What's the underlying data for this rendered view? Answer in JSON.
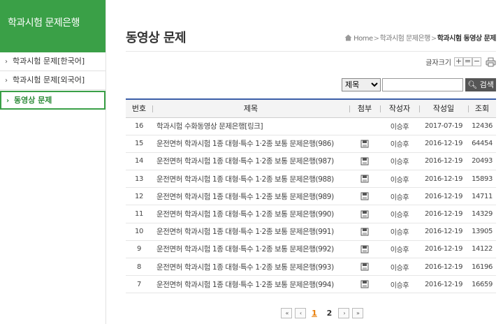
{
  "sidebar": {
    "title": "학과시험 문제은행",
    "items": [
      {
        "label": "학과시험 문제[한국어]",
        "active": false
      },
      {
        "label": "학과시험 문제[외국어]",
        "active": false
      },
      {
        "label": "동영상 문제",
        "active": true
      }
    ]
  },
  "header": {
    "title": "동영상 문제",
    "breadcrumb": {
      "home": "Home",
      "parent": "학과시험 문제은행",
      "current": "학과시험 동영상 문제"
    }
  },
  "fontsize": {
    "label": "글자크기",
    "increase": "+",
    "reset": "=",
    "decrease": "−"
  },
  "search": {
    "field_selected": "제목",
    "query_value": "",
    "button_label": "검색"
  },
  "table": {
    "columns": [
      "번호",
      "제목",
      "첨부",
      "작성자",
      "작성일",
      "조회"
    ],
    "rows": [
      {
        "no": "16",
        "title": "학과시험 수화동영상 문제은행[링크]",
        "attach": false,
        "author": "이승후",
        "date": "2017-07-19",
        "views": "12436"
      },
      {
        "no": "15",
        "title": "운전면허 학과시험 1종 대형·특수 1·2종 보통 문제은행(986)",
        "attach": true,
        "author": "이승후",
        "date": "2016-12-19",
        "views": "64454"
      },
      {
        "no": "14",
        "title": "운전면허 학과시험 1종 대형·특수 1·2종 보통 문제은행(987)",
        "attach": true,
        "author": "이승후",
        "date": "2016-12-19",
        "views": "20493"
      },
      {
        "no": "13",
        "title": "운전면허 학과시험 1종 대형·특수 1·2종 보통 문제은행(988)",
        "attach": true,
        "author": "이승후",
        "date": "2016-12-19",
        "views": "15893"
      },
      {
        "no": "12",
        "title": "운전면허 학과시험 1종 대형·특수 1·2종 보통 문제은행(989)",
        "attach": true,
        "author": "이승후",
        "date": "2016-12-19",
        "views": "14711"
      },
      {
        "no": "11",
        "title": "운전면허 학과시험 1종 대형·특수 1·2종 보통 문제은행(990)",
        "attach": true,
        "author": "이승후",
        "date": "2016-12-19",
        "views": "14329"
      },
      {
        "no": "10",
        "title": "운전면허 학과시험 1종 대형·특수 1·2종 보통 문제은행(991)",
        "attach": true,
        "author": "이승후",
        "date": "2016-12-19",
        "views": "13905"
      },
      {
        "no": "9",
        "title": "운전면허 학과시험 1종 대형·특수 1·2종 보통 문제은행(992)",
        "attach": true,
        "author": "이승후",
        "date": "2016-12-19",
        "views": "14122"
      },
      {
        "no": "8",
        "title": "운전면허 학과시험 1종 대형·특수 1·2종 보통 문제은행(993)",
        "attach": true,
        "author": "이승후",
        "date": "2016-12-19",
        "views": "16196"
      },
      {
        "no": "7",
        "title": "운전면허 학과시험 1종 대형·특수 1·2종 보통 문제은행(994)",
        "attach": true,
        "author": "이승후",
        "date": "2016-12-19",
        "views": "16659"
      }
    ]
  },
  "pagination": {
    "first": "«",
    "prev": "‹",
    "pages": [
      "1",
      "2"
    ],
    "current": "1",
    "next": "›",
    "last": "»"
  },
  "colors": {
    "brand_green": "#3aa047",
    "header_rule_blue": "#3b5ea8",
    "current_page_orange": "#e87a00"
  }
}
